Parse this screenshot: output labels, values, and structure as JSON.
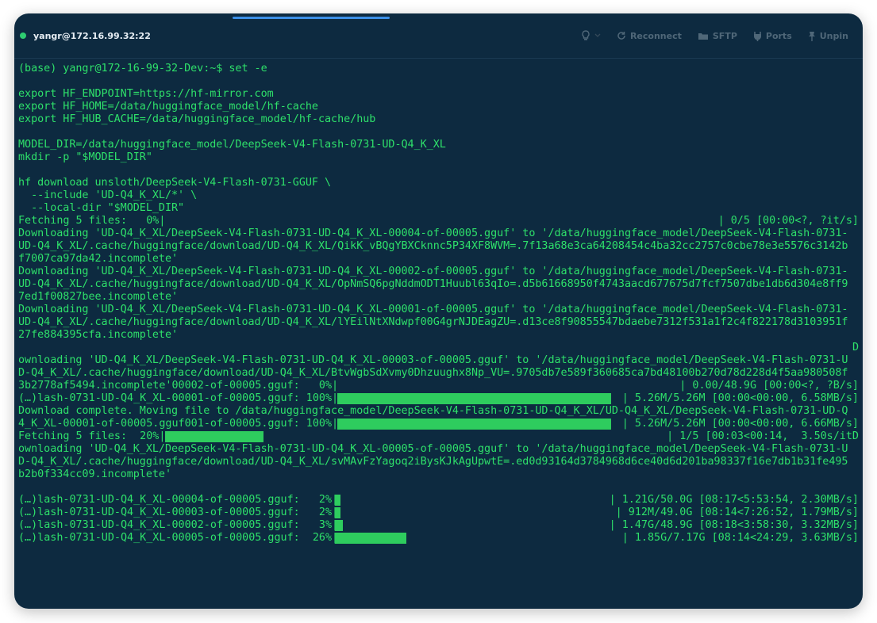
{
  "window": {
    "title": "yangr@172.16.99.32:22",
    "status_color": "#2ecc71"
  },
  "toolbar": {
    "reconnect_label": "Reconnect",
    "sftp_label": "SFTP",
    "ports_label": "Ports",
    "unpin_label": "Unpin",
    "icons": [
      "lightbulb-icon",
      "chevron-down-icon",
      "reconnect-icon",
      "folder-icon",
      "ports-icon",
      "pin-icon"
    ]
  },
  "terminal": {
    "text_color": "#2ee06a",
    "bar_color": "#2ecc5e",
    "lines": {
      "l01": "(base) yangr@172-16-99-32-Dev:~$ set -e",
      "l03": "export HF_ENDPOINT=https://hf-mirror.com",
      "l04": "export HF_HOME=/data/huggingface_model/hf-cache",
      "l05": "export HF_HUB_CACHE=/data/huggingface_model/hf-cache/hub",
      "l07": "MODEL_DIR=/data/huggingface_model/DeepSeek-V4-Flash-0731-UD-Q4_K_XL",
      "l08": "mkdir -p \"$MODEL_DIR\"",
      "l10": "hf download unsloth/DeepSeek-V4-Flash-0731-GGUF \\",
      "l11": "  --include 'UD-Q4_K_XL/*' \\",
      "l12": "  --local-dir \"$MODEL_DIR\"",
      "l13a": "Fetching 5 files:   0%|",
      "l13b": "| 0/5 [00:00<?, ?it/s]",
      "l14": "Downloading 'UD-Q4_K_XL/DeepSeek-V4-Flash-0731-UD-Q4_K_XL-00004-of-00005.gguf' to '/data/huggingface_model/DeepSeek-V4-Flash-0731-",
      "l15": "UD-Q4_K_XL/.cache/huggingface/download/UD-Q4_K_XL/QikK_vBQgYBXCknnc5P34XF8WVM=.7f13a68e3ca64208454c4ba32cc2757c0cbe78e3e5576c3142b",
      "l16": "f7007ca97da42.incomplete'",
      "l17": "Downloading 'UD-Q4_K_XL/DeepSeek-V4-Flash-0731-UD-Q4_K_XL-00002-of-00005.gguf' to '/data/huggingface_model/DeepSeek-V4-Flash-0731-",
      "l18": "UD-Q4_K_XL/.cache/huggingface/download/UD-Q4_K_XL/OpNmSQ6pgNddmODT1Huubl63qIo=.d5b61668950f4743aacd677675d7fcf7507dbe1db6d304e8ff9",
      "l19": "7ed1f00827bee.incomplete'",
      "l20": "Downloading 'UD-Q4_K_XL/DeepSeek-V4-Flash-0731-UD-Q4_K_XL-00001-of-00005.gguf' to '/data/huggingface_model/DeepSeek-V4-Flash-0731-",
      "l21": "UD-Q4_K_XL/.cache/huggingface/download/UD-Q4_K_XL/lYEilNtXNdwpf00G4grNJDEagZU=.d13ce8f90855547bdaebe7312f531a1f2c4f822178d3103951f",
      "l22": "27fe884395cfa.incomplete'",
      "l23": "D",
      "l24": "ownloading 'UD-Q4_K_XL/DeepSeek-V4-Flash-0731-UD-Q4_K_XL-00003-of-00005.gguf' to '/data/huggingface_model/DeepSeek-V4-Flash-0731-U",
      "l25": "D-Q4_K_XL/.cache/huggingface/download/UD-Q4_K_XL/BtvWgbSdXvmy0Dhzuughx8Np_VU=.9705db7e589f360685ca7bd48100b270d78d228d4f5aa980508f",
      "l26a": "3b2778af5494.incomplete'00002-of-00005.gguf:   0%|",
      "l26b": "| 0.00/48.9G [00:00<?, ?B/s]",
      "l27a": "(…)lash-0731-UD-Q4_K_XL-00001-of-00005.gguf: 100%|",
      "l27b": "| 5.26M/5.26M [00:00<00:00, 6.58MB/s]",
      "l28": "Download complete. Moving file to /data/huggingface_model/DeepSeek-V4-Flash-0731-UD-Q4_K_XL/UD-Q4_K_XL/DeepSeek-V4-Flash-0731-UD-Q",
      "l29a": "4_K_XL-00001-of-00005.gguf001-of-00005.gguf: 100%|",
      "l29b": "| 5.26M/5.26M [00:00<00:00, 6.66MB/s]",
      "l30a": "Fetching 5 files:  20%|",
      "l30b": "| 1/5 [00:03<00:14,  3.50s/itD",
      "l31": "ownloading 'UD-Q4_K_XL/DeepSeek-V4-Flash-0731-UD-Q4_K_XL-00005-of-00005.gguf' to '/data/huggingface_model/DeepSeek-V4-Flash-0731-U",
      "l32": "D-Q4_K_XL/.cache/huggingface/download/UD-Q4_K_XL/svMAvFzYagoq2iBysKJkAgUpwtE=.ed0d93164d3784968d6ce40d6d201ba98337f16e7db1b31fe495",
      "l33": "b2b0f334cc09.incomplete'"
    },
    "progress": [
      {
        "label": "(…)lash-0731-UD-Q4_K_XL-00004-of-00005.gguf:   2%|",
        "percent": 2,
        "stats": "| 1.21G/50.0G [08:17<5:53:54, 2.30MB/s]"
      },
      {
        "label": "(…)lash-0731-UD-Q4_K_XL-00003-of-00005.gguf:   2%|",
        "percent": 2,
        "stats": "| 912M/49.0G [08:14<7:26:52, 1.79MB/s]"
      },
      {
        "label": "(…)lash-0731-UD-Q4_K_XL-00002-of-00005.gguf:   3%|",
        "percent": 3,
        "stats": "| 1.47G/48.9G [08:18<3:58:30, 3.32MB/s]"
      },
      {
        "label": "(…)lash-0731-UD-Q4_K_XL-00005-of-00005.gguf:  26%|",
        "percent": 26,
        "stats": "| 1.85G/7.17G [08:14<24:29, 3.63MB/s]"
      }
    ],
    "fetching_20_percent": 20,
    "file1_percent": 100
  }
}
